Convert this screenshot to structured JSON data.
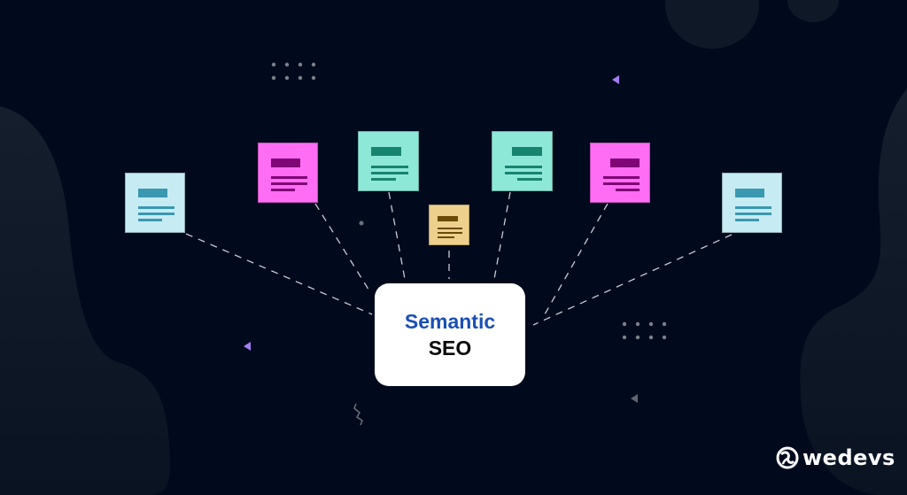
{
  "hub": {
    "line1": "Semantic",
    "line2": "SEO",
    "line1_color": "#1a4fb4",
    "line2_color": "#0a0a0a"
  },
  "brand": {
    "name": "wedevs",
    "icon": "wedevs-logo-icon"
  },
  "colors": {
    "background": "#010a1c",
    "connector": "#c8ccd4",
    "accent_triangle": "#a57cf2"
  },
  "documents": [
    {
      "name": "doc-light-blue-left",
      "bg": "#c6ebf2",
      "ink": "#3a98b0",
      "title_align": "left"
    },
    {
      "name": "doc-pink-left",
      "bg": "#ff6df5",
      "ink": "#7e0675",
      "title_align": "left"
    },
    {
      "name": "doc-mint-left",
      "bg": "#8ee8d8",
      "ink": "#17846f",
      "title_align": "left"
    },
    {
      "name": "doc-tan-center",
      "bg": "#edd08c",
      "ink": "#6a4a05",
      "title_align": "left"
    },
    {
      "name": "doc-mint-right",
      "bg": "#8ee8d8",
      "ink": "#17846f",
      "title_align": "right"
    },
    {
      "name": "doc-pink-right",
      "bg": "#ff6df5",
      "ink": "#7e0675",
      "title_align": "right"
    },
    {
      "name": "doc-light-blue-right",
      "bg": "#c6ebf2",
      "ink": "#3a98b0",
      "title_align": "left"
    }
  ]
}
